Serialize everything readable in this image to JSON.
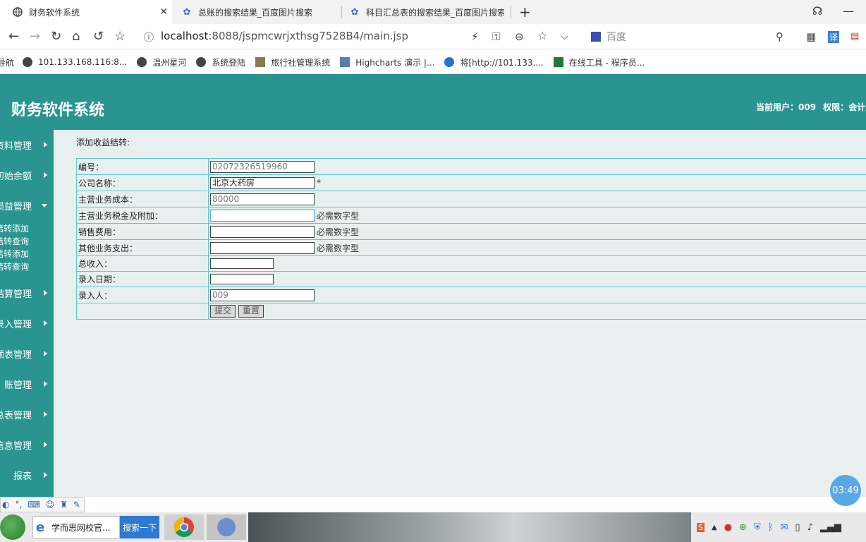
{
  "browser": {
    "tabs": [
      {
        "title": "财务软件系统",
        "active": true
      },
      {
        "title": "总账的搜索结果_百度图片搜索",
        "active": false
      },
      {
        "title": "科目汇总表的搜索结果_百度图片搜索",
        "active": false
      }
    ],
    "url_host": "localhost",
    "url_path": ":8088/jspmcwrjxthsg7528B4/main.jsp",
    "search_engine": "百度",
    "bookmarks": [
      "导航",
      "101.133.168.116:8...",
      "温州星河",
      "系统登陆",
      "旅行社管理系统",
      "Highcharts 演示 |...",
      "将[http://101.133....",
      "在线工具 - 程序员..."
    ]
  },
  "app": {
    "title": "财务软件系统",
    "user_label": "当前用户：",
    "user": "009",
    "role_label": "权限：",
    "role": "会计人",
    "accent": "#2a9590"
  },
  "sidebar": {
    "items": [
      {
        "label": "资料管理",
        "expanded": false
      },
      {
        "label": "初始余额",
        "expanded": false
      },
      {
        "label": "损益管理",
        "expanded": true
      },
      {
        "label": "结算管理",
        "expanded": false
      },
      {
        "label": "录入管理",
        "expanded": false
      },
      {
        "label": "余额表管理",
        "expanded": false
      },
      {
        "label": "账管理",
        "expanded": false
      },
      {
        "label": "汇总表管理",
        "expanded": false
      },
      {
        "label": "信息管理",
        "expanded": false
      },
      {
        "label": "报表",
        "expanded": false
      }
    ],
    "subitems": [
      "结转添加",
      "结转查询",
      "结转添加",
      "结转查询"
    ]
  },
  "form": {
    "title": "添加收益结转:",
    "rows": [
      {
        "label": "编号：",
        "value": "02072326519960",
        "hint": ""
      },
      {
        "label": "公司名称：",
        "value": "北京大药房",
        "hint": "*"
      },
      {
        "label": "主营业务成本：",
        "value": "80000",
        "hint": ""
      },
      {
        "label": "主营业务税金及附加：",
        "value": "",
        "hint": "必需数字型"
      },
      {
        "label": "销售费用：",
        "value": "",
        "hint": "必需数字型"
      },
      {
        "label": "其他业务支出：",
        "value": "",
        "hint": "必需数字型"
      },
      {
        "label": "总收入：",
        "value": "",
        "hint": ""
      },
      {
        "label": "录入日期：",
        "value": "",
        "hint": ""
      },
      {
        "label": "录入人：",
        "value": "009",
        "hint": ""
      }
    ],
    "submit_label": "提交",
    "reset_label": "重置"
  },
  "timer": "03:49",
  "taskbar": {
    "ie_label": "学而思网校官...",
    "search_label": "搜索一下"
  }
}
